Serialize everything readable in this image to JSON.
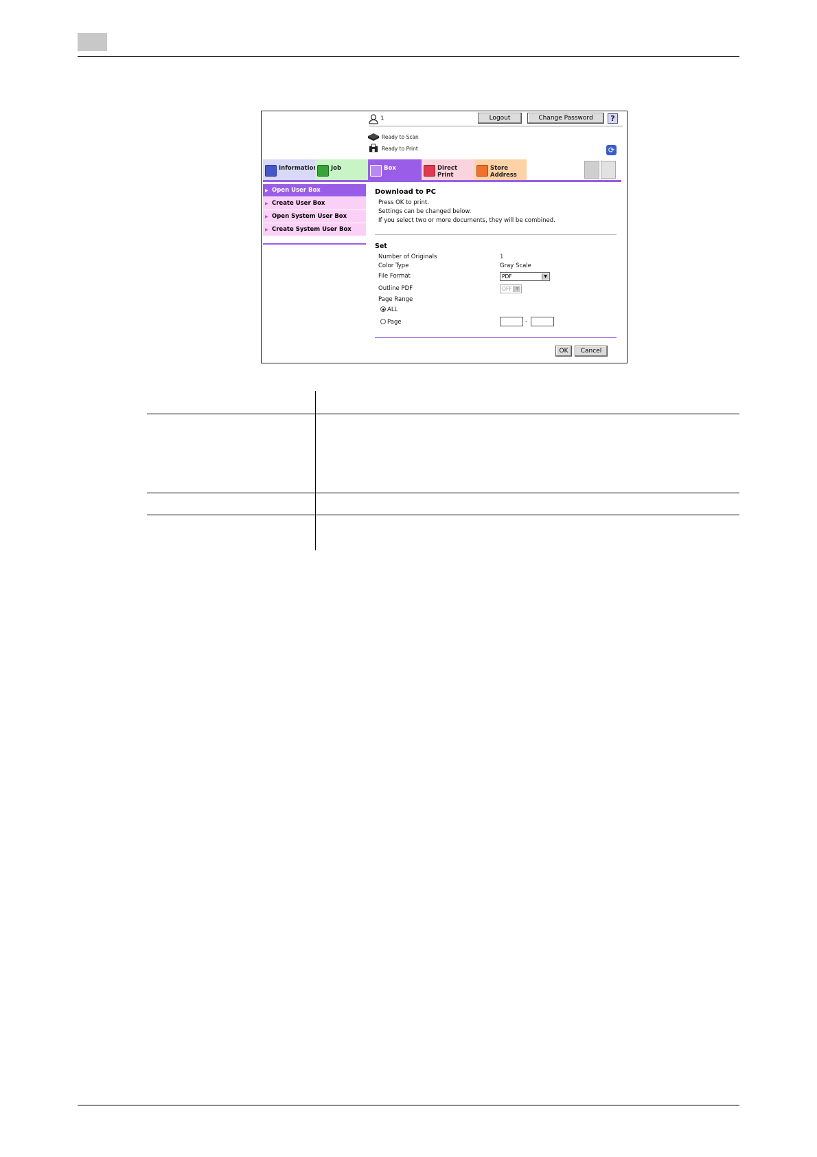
{
  "header": {
    "user_id": "1",
    "logout_label": "Logout",
    "change_password_label": "Change Password",
    "help_symbol": "?"
  },
  "status": {
    "scan": "Ready to Scan",
    "print": "Ready to Print"
  },
  "tabs": [
    {
      "label": "Information",
      "color": "#d7d9f6"
    },
    {
      "label": "Job",
      "color": "#c9f5c6"
    },
    {
      "label": "Box",
      "color": "#9a5de8"
    },
    {
      "label": "Direct Print",
      "color": "#fbd3dc"
    },
    {
      "label": "Store Address",
      "color": "#fdd2a6"
    }
  ],
  "sidebar": {
    "items": [
      {
        "label": "Open User Box",
        "active": true
      },
      {
        "label": "Create User Box"
      },
      {
        "label": "Open System User Box"
      },
      {
        "label": "Create System User Box"
      }
    ]
  },
  "main": {
    "title": "Download to PC",
    "lines": [
      "Press OK to print.",
      "Settings can be changed below.",
      "If you select two or more documents, they will be combined."
    ],
    "set_heading": "Set",
    "fields": {
      "originals_label": "Number of Originals",
      "originals_value": "1",
      "color_label": "Color Type",
      "color_value": "Gray Scale",
      "format_label": "File Format",
      "format_value": "PDF",
      "outline_label": "Outline PDF",
      "outline_value": "OFF",
      "range_label": "Page Range",
      "range_all": "ALL",
      "range_page": "Page",
      "range_sep": "-"
    },
    "ok_label": "OK",
    "cancel_label": "Cancel"
  },
  "colors": {
    "accent": "#9a5de8",
    "sidebar_bg": "#fbd0f6"
  }
}
